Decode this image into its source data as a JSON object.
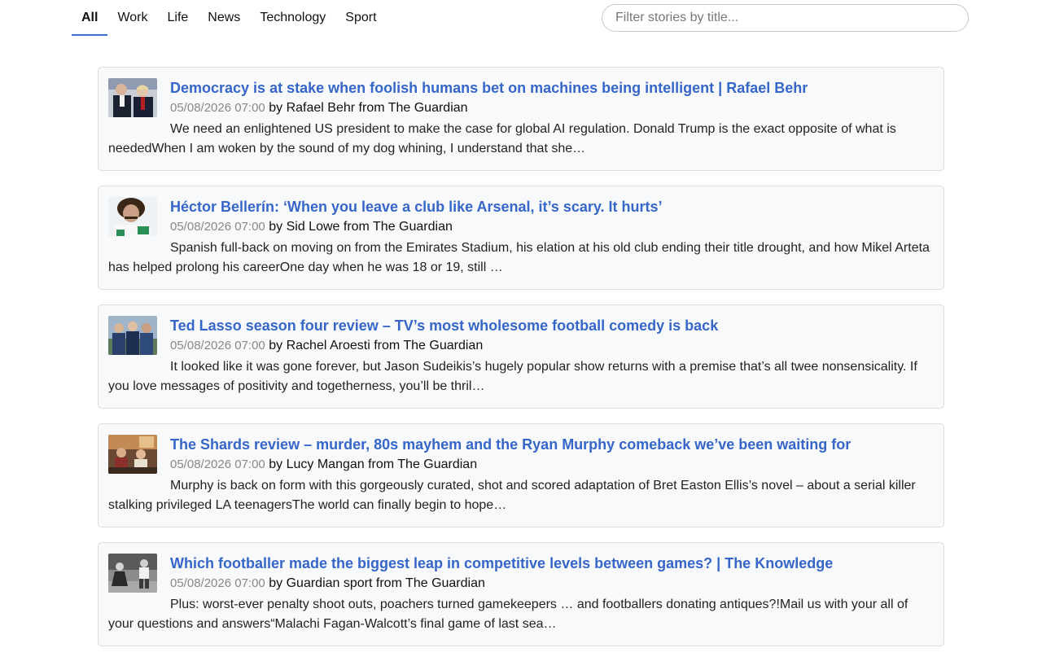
{
  "nav": {
    "tabs": [
      {
        "label": "All",
        "active": true
      },
      {
        "label": "Work",
        "active": false
      },
      {
        "label": "Life",
        "active": false
      },
      {
        "label": "News",
        "active": false
      },
      {
        "label": "Technology",
        "active": false
      },
      {
        "label": "Sport",
        "active": false
      }
    ]
  },
  "search": {
    "placeholder": "Filter stories by title...",
    "value": ""
  },
  "stories": [
    {
      "title": "Democracy is at stake when foolish humans bet on machines being intelligent | Rafael Behr",
      "date": "05/08/2026 07:00",
      "by_word": "by",
      "author": "Rafael Behr",
      "from_word": "from",
      "source": "The Guardian",
      "summary": "We need an enlightened US president to make the case for global AI regulation. Donald Trump is the exact opposite of what is neededWhen I am woken by the sound of my dog whining, I understand that she…",
      "thumb": "politicians-photo-icon"
    },
    {
      "title": "Héctor Bellerín: ‘When you leave a club like Arsenal, it’s scary. It hurts’",
      "date": "05/08/2026 07:00",
      "by_word": "by",
      "author": "Sid Lowe",
      "from_word": "from",
      "source": "The Guardian",
      "summary": "Spanish full-back on moving on from the Emirates Stadium, his elation at his old club ending their title drought, and how Mikel Arteta has helped prolong his careerOne day when he was 18 or 19, still …",
      "thumb": "portrait-photo-icon"
    },
    {
      "title": "Ted Lasso season four review – TV’s most wholesome football comedy is back",
      "date": "05/08/2026 07:00",
      "by_word": "by",
      "author": "Rachel Aroesti",
      "from_word": "from",
      "source": "The Guardian",
      "summary": "It looked like it was gone forever, but Jason Sudeikis’s hugely popular show returns with a premise that’s all twee nonsensicality. If you love messages of positivity and togetherness, you’ll be thril…",
      "thumb": "tv-show-photo-icon"
    },
    {
      "title": "The Shards review – murder, 80s mayhem and the Ryan Murphy comeback we’ve been waiting for",
      "date": "05/08/2026 07:00",
      "by_word": "by",
      "author": "Lucy Mangan",
      "from_word": "from",
      "source": "The Guardian",
      "summary": "Murphy is back on form with this gorgeously curated, shot and scored adaptation of Bret Easton Ellis’s novel – about a serial killer stalking privileged LA teenagersThe world can finally begin to hope…",
      "thumb": "drama-scene-photo-icon"
    },
    {
      "title": "Which footballer made the biggest leap in competitive levels between games? | The Knowledge",
      "date": "05/08/2026 07:00",
      "by_word": "by",
      "author": "Guardian sport",
      "from_word": "from",
      "source": "The Guardian",
      "summary": "Plus: worst-ever penalty shoot outs, poachers turned gamekeepers … and footballers donating antiques?!Mail us with your all of your questions and answers“Malachi Fagan-Walcott’s final game of last sea…",
      "thumb": "football-photo-icon"
    }
  ]
}
